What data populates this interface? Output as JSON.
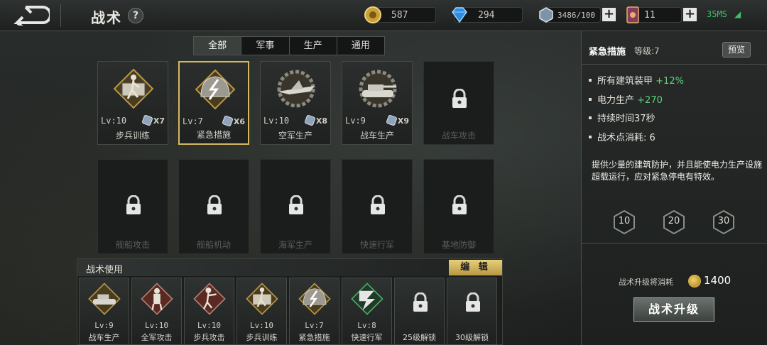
{
  "header": {
    "title": "战术",
    "help": "?",
    "gold": "587",
    "diamond": "294",
    "steel": "3486/100",
    "cards": "11",
    "ping": "35MS"
  },
  "tabs": [
    "全部",
    "军事",
    "生产",
    "通用"
  ],
  "tactics": [
    {
      "name": "步兵训练",
      "lv": "Lv:10",
      "count": "X7"
    },
    {
      "name": "紧急措施",
      "lv": "Lv:7",
      "count": "X6"
    },
    {
      "name": "空军生产",
      "lv": "Lv:10",
      "count": "X8"
    },
    {
      "name": "战车生产",
      "lv": "Lv:9",
      "count": "X9"
    },
    {
      "name": "战车攻击"
    },
    {
      "name": "舰船攻击"
    },
    {
      "name": "舰船机动"
    },
    {
      "name": "海军生产"
    },
    {
      "name": "快速行军"
    },
    {
      "name": "基地防御"
    }
  ],
  "usage": {
    "title": "战术使用",
    "edit": "编 辑",
    "slots": [
      {
        "lv": "Lv:9",
        "name": "战车生产"
      },
      {
        "lv": "Lv:10",
        "name": "全军攻击"
      },
      {
        "lv": "Lv:10",
        "name": "步兵攻击"
      },
      {
        "lv": "Lv:10",
        "name": "步兵训练"
      },
      {
        "lv": "Lv:7",
        "name": "紧急措施"
      },
      {
        "lv": "Lv:8",
        "name": "快速行军"
      },
      {
        "lv": "",
        "name": "25级解锁"
      },
      {
        "lv": "",
        "name": "30级解锁"
      }
    ]
  },
  "detail": {
    "name": "紧急措施",
    "level": "等级:7",
    "preview": "预览",
    "stats": [
      {
        "label": "所有建筑装甲",
        "value": "+12%"
      },
      {
        "label": "电力生产",
        "value": "+270"
      },
      {
        "label": "持续时间",
        "value": "37秒"
      },
      {
        "label": "战术点消耗:",
        "value": "6"
      }
    ],
    "description": "提供少量的建筑防护，并且能使电力生产设施超载运行，应对紧急停电有特效。",
    "level_buttons": [
      "10",
      "20",
      "30"
    ],
    "cost_label": "战术升级将消耗",
    "cost_value": "1400",
    "upgrade": "战术升级"
  },
  "colors": {
    "accent_gold": "#d6b860",
    "positive_green": "#5fd27a",
    "ping_green": "#3fbf6b"
  }
}
